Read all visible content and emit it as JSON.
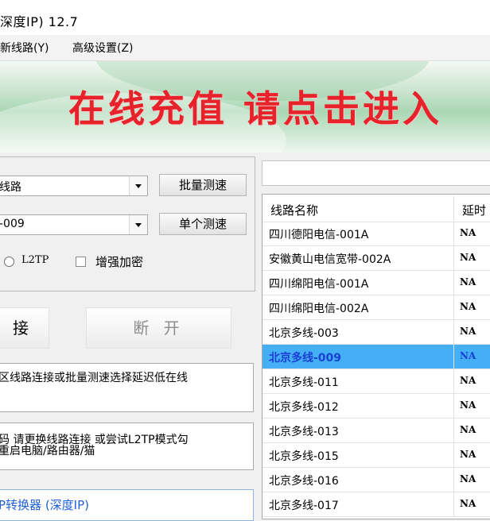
{
  "window": {
    "title": "深度IP) 12.7"
  },
  "menu": [
    {
      "label": "新线路(Y)"
    },
    {
      "label": "高级设置(Z)"
    }
  ],
  "banner": {
    "text": "在线充值 请点击进入"
  },
  "controls": {
    "line_type_combo": "线路",
    "line_select_combo": "-009",
    "batch_test_label": "批量测速",
    "single_test_label": "单个测速",
    "l2tp_label": "L2TP",
    "enhance_label": "增强加密",
    "connect_label": "接",
    "disconnect_label": "断 开"
  },
  "messages": {
    "tip": "区线路连接或批量测速选择延迟低在线",
    "warn_line1": "码 请更换线路连接 或尝试L2TP模式勾",
    "warn_line2": "重启电脑/路由器/猫",
    "product": "P转换器 (深度IP)"
  },
  "table": {
    "columns": [
      "线路名称",
      "延时"
    ],
    "selected_index": 5,
    "rows": [
      {
        "name": "四川德阳电信-001A",
        "delay": "NA"
      },
      {
        "name": "安徽黄山电信宽带-002A",
        "delay": "NA"
      },
      {
        "name": "四川绵阳电信-001A",
        "delay": "NA"
      },
      {
        "name": "四川绵阳电信-002A",
        "delay": "NA"
      },
      {
        "name": "北京多线-003",
        "delay": "NA"
      },
      {
        "name": "北京多线-009",
        "delay": "NA"
      },
      {
        "name": "北京多线-011",
        "delay": "NA"
      },
      {
        "name": "北京多线-012",
        "delay": "NA"
      },
      {
        "name": "北京多线-013",
        "delay": "NA"
      },
      {
        "name": "北京多线-015",
        "delay": "NA"
      },
      {
        "name": "北京多线-016",
        "delay": "NA"
      },
      {
        "name": "北京多线-017",
        "delay": "NA"
      }
    ]
  },
  "colors": {
    "banner_text": "#e8222a",
    "selection": "#44aff5",
    "selected_text": "#1b40d6"
  }
}
